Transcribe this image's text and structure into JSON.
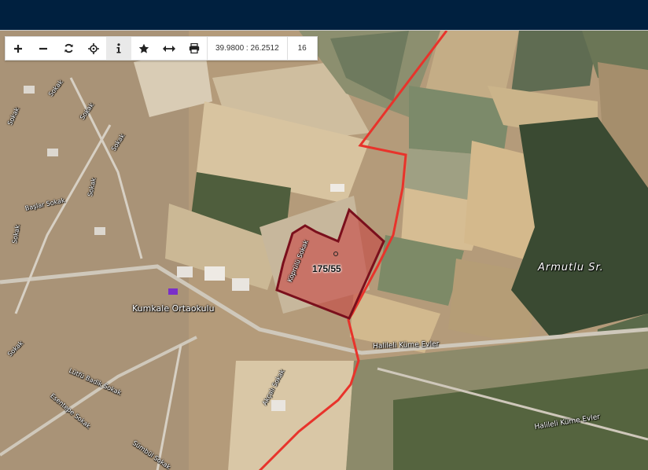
{
  "toolbar": {
    "buttons": [
      {
        "icon": "zoom-in-icon"
      },
      {
        "icon": "zoom-out-icon"
      },
      {
        "icon": "refresh-icon"
      },
      {
        "icon": "locate-icon"
      },
      {
        "icon": "info-icon",
        "active": true
      },
      {
        "icon": "star-icon"
      },
      {
        "icon": "measure-icon"
      },
      {
        "icon": "print-icon"
      }
    ],
    "coordinates": "39.9800 : 26.2512",
    "zoom_level": "16"
  },
  "parcel": {
    "label": "175/55",
    "outline_color": "#7a0f1c",
    "fill_color": "#c83c3c"
  },
  "boundary_color": "#e8332b",
  "labels": {
    "armutlu": "Armutlu Sr.",
    "kumkale_school": "Kumkale Ortaokulu",
    "halileli_1": "Halileli Küme Evler",
    "halileli_2": "Halileli Küme Evler",
    "baslar": "Başlar Sokak",
    "lutfu_badik": "Lütfü Badik Sokak",
    "esentepe": "Esentepe Sokak",
    "sumbul": "Sümbül Sokak",
    "akcali": "Akçalı Sokak",
    "kopruulu": "Köprülü Sokak",
    "top_sok_1": "Sokak",
    "top_sok_2": "Sokak",
    "top_sok_3": "Sokak",
    "top_sok_4": "Sokak",
    "left_sok_1": "Sokak",
    "left_sok_2": "Sokak",
    "left_sok_3": "Sokak"
  }
}
